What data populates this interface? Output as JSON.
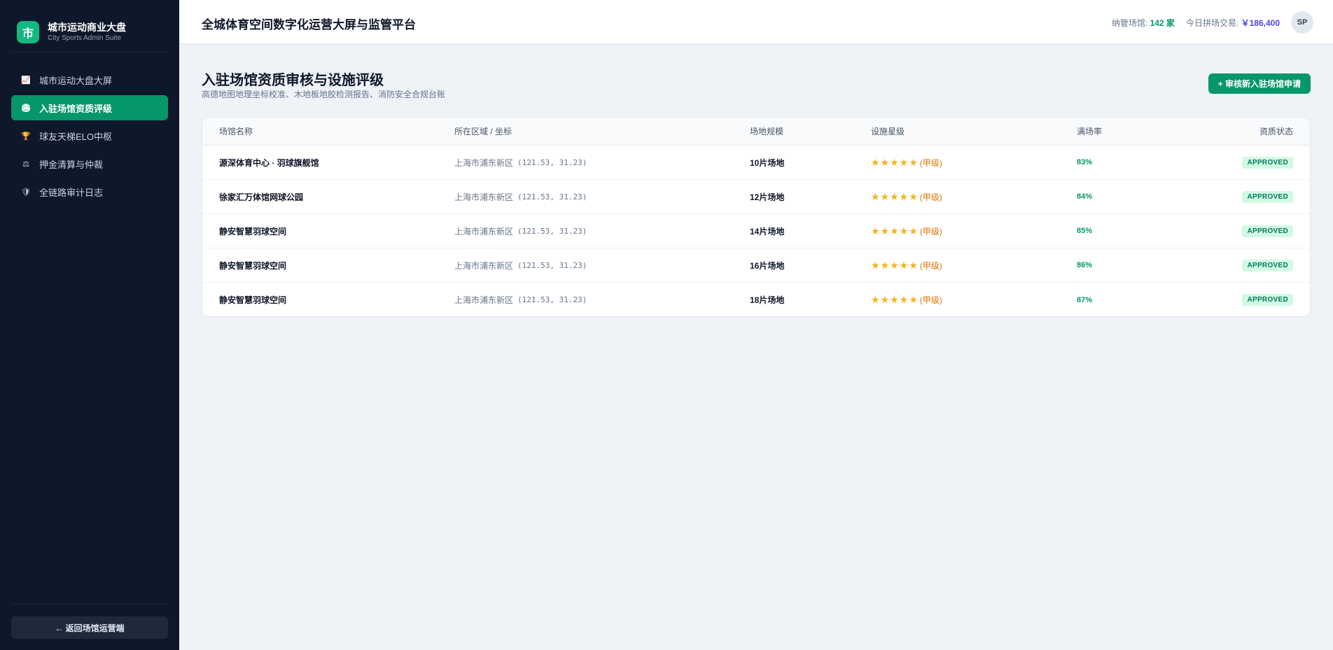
{
  "sidebar": {
    "logo_char": "市",
    "title": "城市运动商业大盘",
    "subtitle": "City Sports Admin Suite",
    "items": [
      {
        "icon": "📈",
        "icon_name": "chart-icon",
        "label": "城市运动大盘大屏",
        "active": false
      },
      {
        "icon": "🏟",
        "icon_name": "stadium-icon",
        "label": "入驻场馆资质评级",
        "active": true
      },
      {
        "icon": "🏆",
        "icon_name": "trophy-icon",
        "label": "球友天梯ELO中枢",
        "active": false
      },
      {
        "icon": "⚖",
        "icon_name": "scale-icon",
        "label": "押金清算与仲裁",
        "active": false
      },
      {
        "icon": "🛡",
        "icon_name": "shield-icon",
        "label": "全链路审计日志",
        "active": false
      }
    ],
    "back_label": "← 返回场馆运营端"
  },
  "header": {
    "title": "全城体育空间数字化运营大屏与监管平台",
    "venues_label": "纳管场馆: ",
    "venues_value": "142 家",
    "trade_label": "今日拼场交易: ",
    "trade_value": "￥186,400",
    "avatar": "SP"
  },
  "main": {
    "title": "入驻场馆资质审核与设施评级",
    "subtitle": "高德地图地理坐标校准、木地板地胶检测报告、消防安全合规台账",
    "primary_button": "+ 审核新入驻场馆申请",
    "table": {
      "columns": [
        "场馆名称",
        "所在区域 / 坐标",
        "场地规模",
        "设施星级",
        "满场率",
        "资质状态"
      ],
      "rows": [
        {
          "name": "源深体育中心 · 羽球旗舰馆",
          "region": "上海市浦东新区",
          "coord": "(121.53, 31.23)",
          "scale": "10片场地",
          "stars": "★★★★★",
          "grade": "(甲级)",
          "rate": "83%",
          "status": "APPROVED"
        },
        {
          "name": "徐家汇万体馆网球公园",
          "region": "上海市浦东新区",
          "coord": "(121.53, 31.23)",
          "scale": "12片场地",
          "stars": "★★★★★",
          "grade": "(甲级)",
          "rate": "84%",
          "status": "APPROVED"
        },
        {
          "name": "静安智慧羽球空间",
          "region": "上海市浦东新区",
          "coord": "(121.53, 31.23)",
          "scale": "14片场地",
          "stars": "★★★★★",
          "grade": "(甲级)",
          "rate": "85%",
          "status": "APPROVED"
        },
        {
          "name": "静安智慧羽球空间",
          "region": "上海市浦东新区",
          "coord": "(121.53, 31.23)",
          "scale": "16片场地",
          "stars": "★★★★★",
          "grade": "(甲级)",
          "rate": "86%",
          "status": "APPROVED"
        },
        {
          "name": "静安智慧羽球空间",
          "region": "上海市浦东新区",
          "coord": "(121.53, 31.23)",
          "scale": "18片场地",
          "stars": "★★★★★",
          "grade": "(甲级)",
          "rate": "87%",
          "status": "APPROVED"
        }
      ]
    }
  },
  "colors": {
    "sidebar_bg": "#0f172a",
    "accent": "#059669",
    "star": "#f5b31b",
    "grade": "#d97706",
    "approved_bg": "#d1fae5",
    "approved_text": "#047857"
  }
}
